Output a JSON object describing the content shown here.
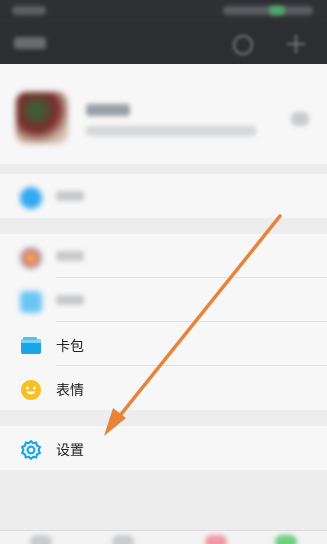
{
  "menu": {
    "card_label": "卡包",
    "emoji_label": "表情",
    "settings_label": "设置"
  },
  "icons": {
    "blurred_row_1": "blue-circle-icon",
    "blurred_row_2": "colorful-flower-icon",
    "blurred_row_3": "blue-image-icon",
    "card": "card-wallet-icon",
    "emoji": "smiley-face-icon",
    "settings": "gear-icon",
    "annotation": "orange-arrow"
  },
  "colors": {
    "accent_blue": "#1aa7e8",
    "emoji_yellow": "#f7c021",
    "annotation_orange": "#e7833a",
    "dark_bar": "#2d2e31"
  }
}
